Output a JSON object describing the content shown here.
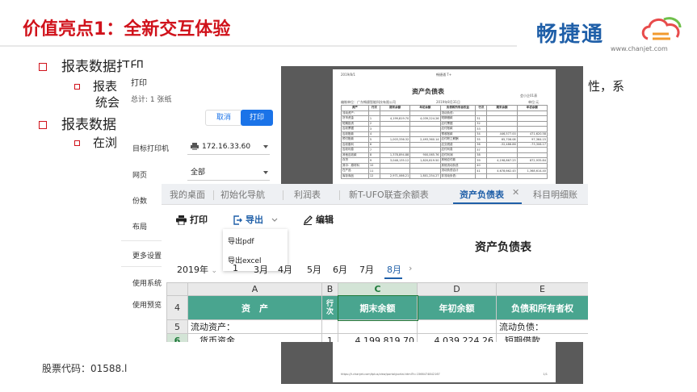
{
  "slide": {
    "title": "价值亮点1：全新交互体验",
    "stock_code": "股票代码：01588.l"
  },
  "logo": {
    "text": "畅捷通",
    "url": "www.chanjet.com"
  },
  "bullets": [
    {
      "text": "报表数据打印"
    },
    {
      "sub": "报表",
      "sub_tail": "性，系",
      "sub_line2": "统会"
    },
    {
      "text": "报表数据"
    },
    {
      "sub": "在浏"
    }
  ],
  "print_dialog": {
    "title": "打印",
    "total": "总计: 1 张纸",
    "cancel": "取消",
    "print": "打印",
    "fields": [
      {
        "label": "目标打印机",
        "value": "172.16.33.60"
      },
      {
        "label": "网页",
        "value": "全部"
      },
      {
        "label": "份数",
        "value": ""
      },
      {
        "label": "布局",
        "value": ""
      }
    ],
    "more_settings": "更多设置",
    "use_system": "使用系统",
    "use_preview": "使用预览"
  },
  "preview": {
    "header_left": "2019/8/1",
    "header_center": "畅捷通 T+",
    "title": "资产负债表",
    "subtitle_right": "会小企01表",
    "company": "编制单位：广东畅捷智能科技有限公司",
    "date": "2019年8月31日",
    "unit": "单位:元",
    "columns": [
      "资产",
      "行次",
      "期末余额",
      "年初余额",
      "负债和所有者权益",
      "行次",
      "期末余额",
      "年初余额"
    ],
    "rows": [
      [
        "流动资产：",
        "",
        "",
        "",
        "流动负债：",
        "",
        "",
        ""
      ],
      [
        "货币资金",
        "1",
        "4,199,819.70",
        "4,039,224.26",
        "短期借款",
        "31",
        "",
        ""
      ],
      [
        "短期投资",
        "2",
        "",
        "",
        "应付票据",
        "32",
        "",
        ""
      ],
      [
        "应收票据",
        "3",
        "",
        "",
        "应付账款",
        "33",
        "",
        ""
      ],
      [
        "应收账款",
        "4",
        "",
        "",
        "预收账款",
        "34",
        "446,577.00",
        "471,620.58"
      ],
      [
        "预付账款",
        "5",
        "1,003,336.32",
        "2,493,360.14",
        "应付职工薪酬",
        "35",
        "65,706.08",
        "97,364.15"
      ],
      [
        "应收股利",
        "6",
        "",
        "",
        "应交税费",
        "36",
        "-32,486.86",
        "-73,306.17"
      ],
      [
        "应收利息",
        "7",
        "",
        "",
        "应付利息",
        "37",
        "",
        ""
      ],
      [
        "其他应收款",
        "8",
        "1,378,894.88",
        "900,065.76",
        "应付利润",
        "38",
        "",
        ""
      ],
      [
        "存货",
        "9",
        "3,048,135.12",
        "1,820,819.50",
        "其他应付款",
        "39",
        "4,198,867.23",
        "872,935.84"
      ],
      [
        "其中：原材料",
        "10",
        "",
        "",
        "其他流动负债",
        "40",
        "",
        ""
      ],
      [
        "在产品",
        "11",
        "",
        "",
        "流动负债合计",
        "41",
        "4,678,662.43",
        "1,368,614.40"
      ],
      [
        "库存商品",
        "12",
        "2,971,066.21",
        "1,801,254.27",
        "非流动负债：",
        "",
        "",
        ""
      ]
    ],
    "footer_url": "https://t.chanjet.com/tplus/view/portal/portal.html?t=1566474842167",
    "page_no": "1/1"
  },
  "app": {
    "tabs": [
      "我的桌面",
      "初始化导航",
      "利润表",
      "新T-UFO联查余额表",
      "资产负债表",
      "科目明细账"
    ],
    "active_tab": "资产负债表",
    "toolbar": {
      "print": "打印",
      "export": "导出",
      "edit": "编辑"
    },
    "export_menu": [
      "导出pdf",
      "导出excel"
    ],
    "report_title": "资产负债表",
    "year": "2019年",
    "months": [
      "4月",
      "5月",
      "6月",
      "7月",
      "8月"
    ],
    "months_partial": [
      "1",
      "3月"
    ],
    "active_month": "8月",
    "grid": {
      "col_headers": [
        "",
        "A",
        "B",
        "C",
        "D",
        "E"
      ],
      "selected_col": "C",
      "header_row": {
        "row": "4",
        "cells": [
          "资　产",
          "行次",
          "期末余额",
          "年初余额",
          "负债和所有者权"
        ]
      },
      "rows": [
        {
          "row": "5",
          "cells": [
            "流动资产：",
            "",
            "",
            "",
            "流动负债："
          ]
        },
        {
          "row": "6",
          "cells": [
            "货币资金",
            "1",
            "4,199,819.70",
            "4,039,224.26",
            "短期借款"
          ]
        }
      ]
    }
  },
  "colors": {
    "title_red": "#d0121b",
    "brand_blue": "#1f5fa8",
    "header_green": "#49a58f",
    "print_blue": "#1a73e8"
  }
}
